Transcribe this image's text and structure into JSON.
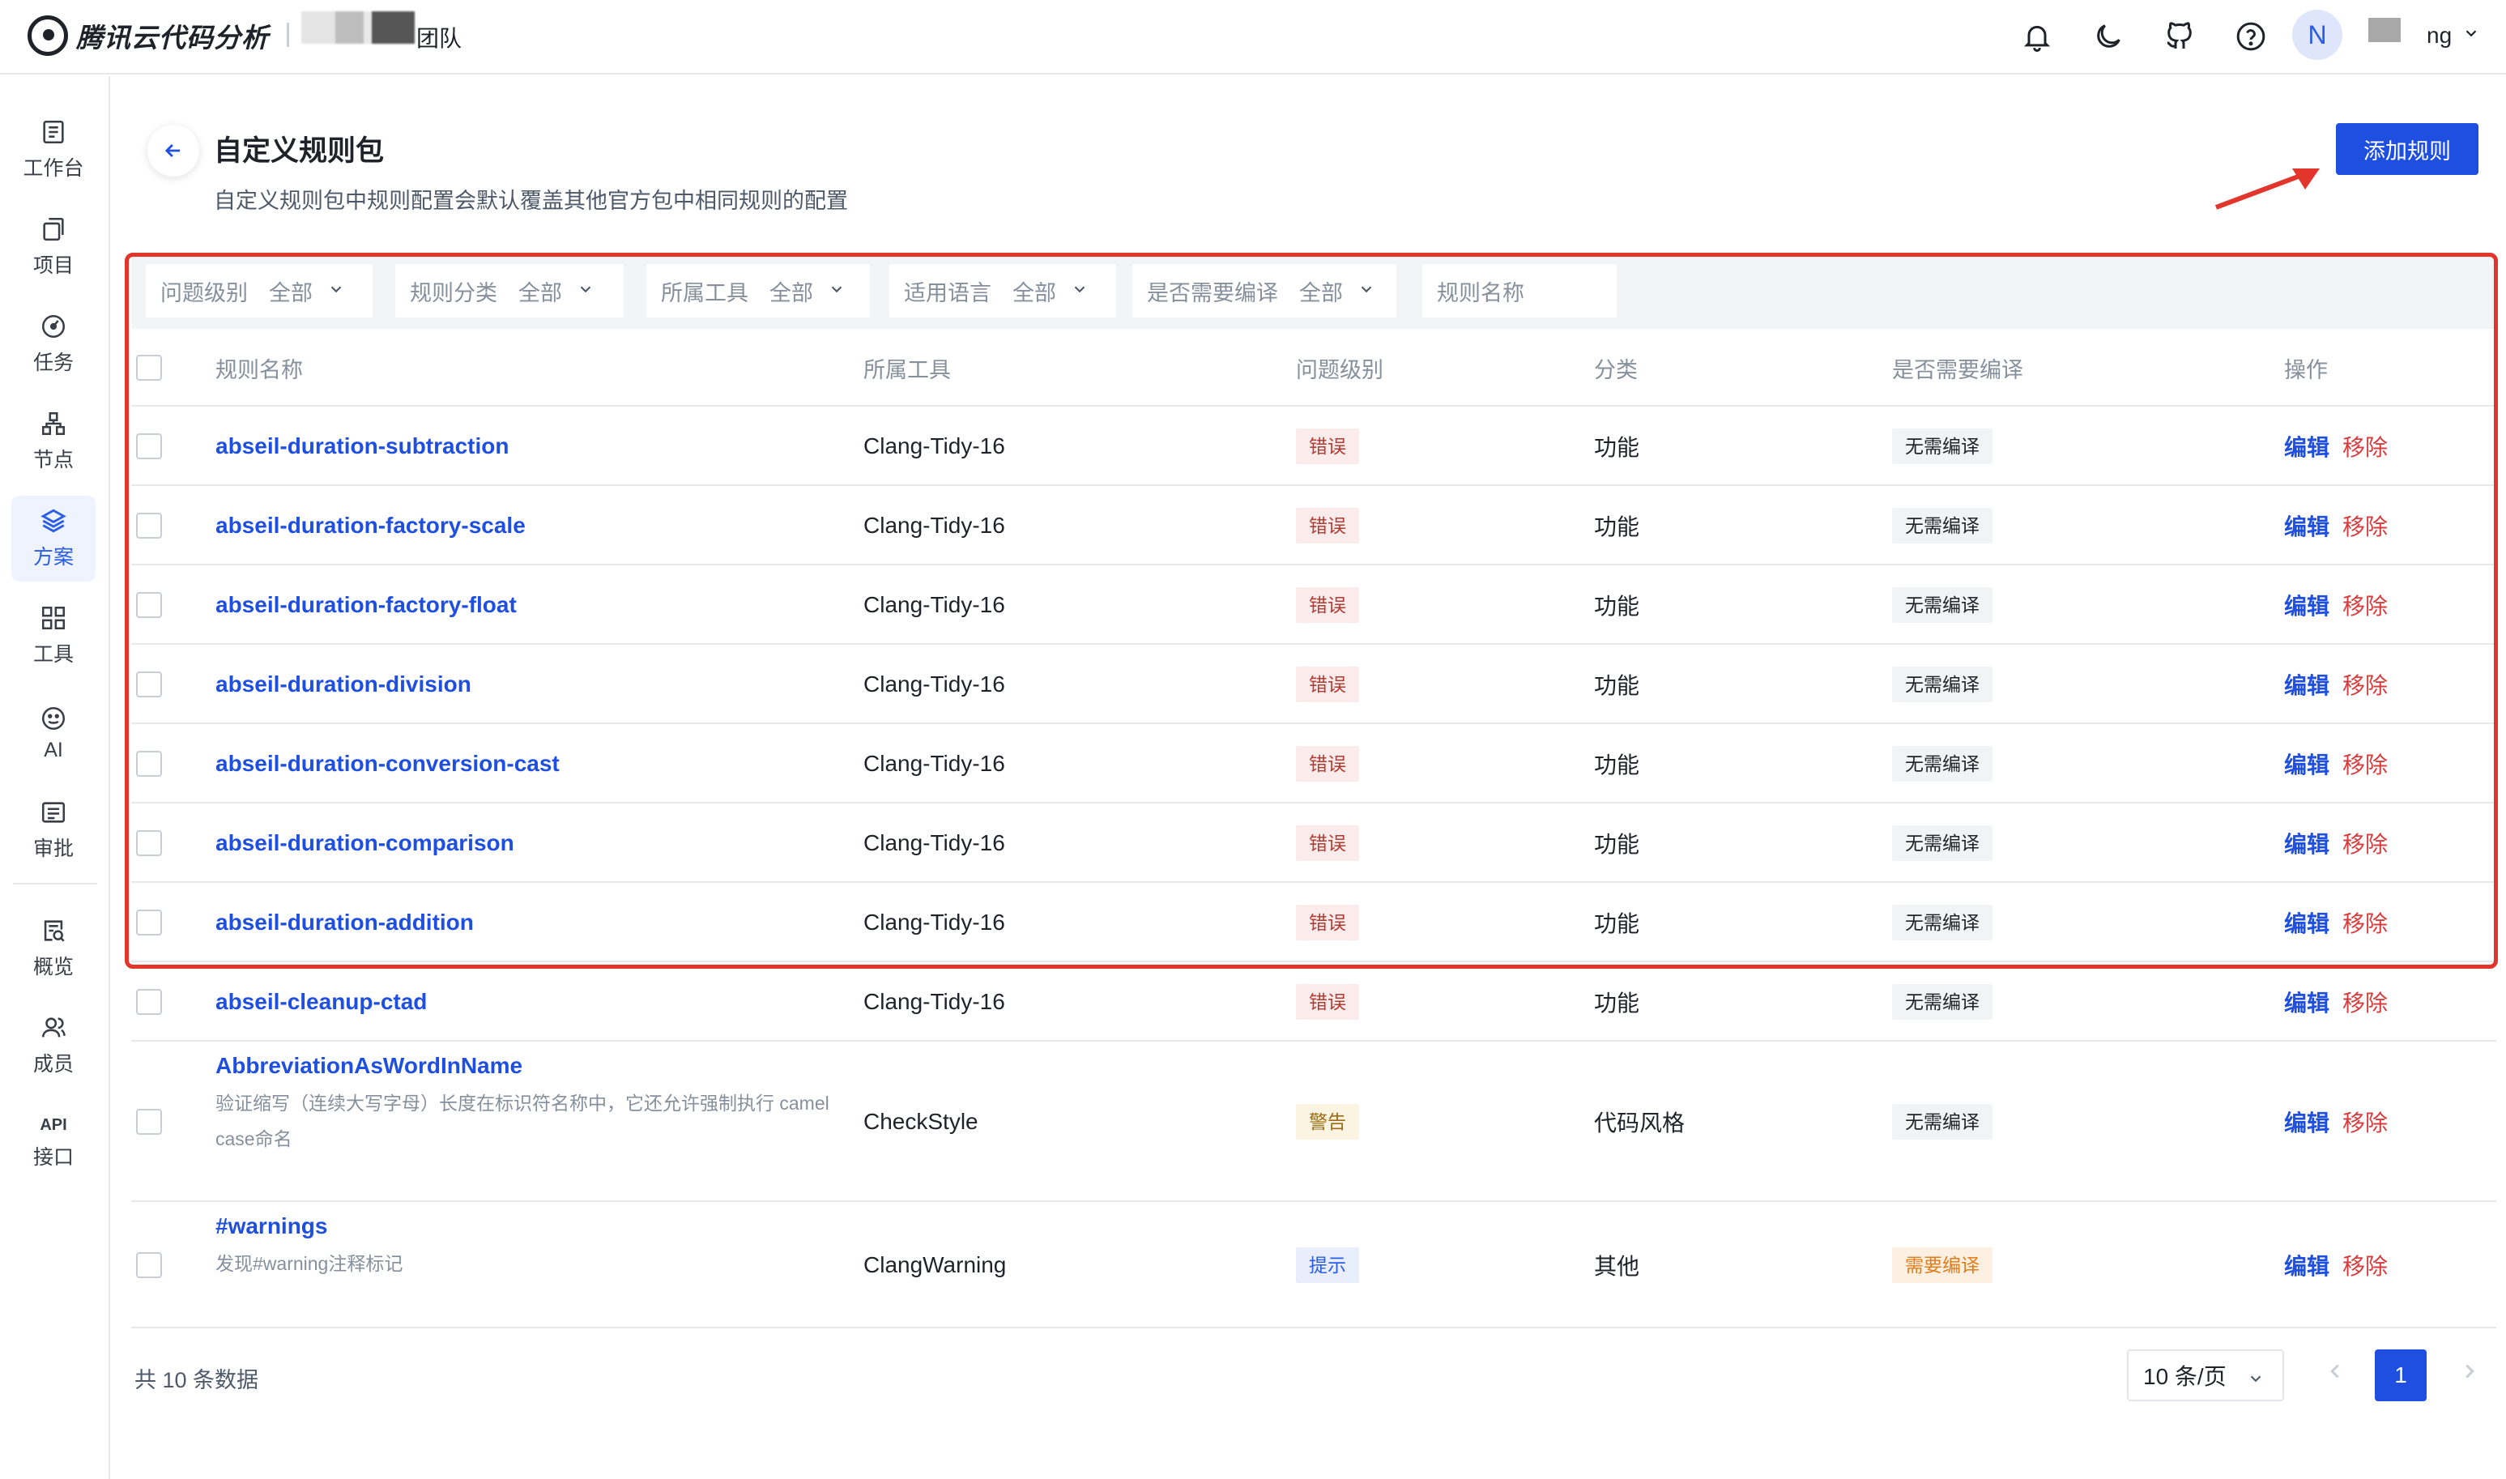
{
  "app": {
    "logo_text": "腾讯云代码分析",
    "team_name": "团队",
    "user_initial": "N",
    "user_name": "ng"
  },
  "topbar_icons": [
    "bell-icon",
    "moon-icon",
    "github-icon",
    "help-icon"
  ],
  "sidebar": {
    "items": [
      {
        "label": "工作台",
        "icon": "workbench-icon"
      },
      {
        "label": "项目",
        "icon": "project-icon"
      },
      {
        "label": "任务",
        "icon": "task-icon"
      },
      {
        "label": "节点",
        "icon": "node-icon"
      },
      {
        "label": "方案",
        "icon": "scheme-icon",
        "active": true
      },
      {
        "label": "工具",
        "icon": "tools-icon"
      },
      {
        "label": "AI",
        "icon": "ai-icon"
      },
      {
        "label": "审批",
        "icon": "approval-icon"
      },
      {
        "label": "概览",
        "icon": "overview-icon"
      },
      {
        "label": "成员",
        "icon": "members-icon"
      },
      {
        "label": "接口",
        "icon_text": "API"
      }
    ]
  },
  "header": {
    "title": "自定义规则包",
    "subtitle": "自定义规则包中规则配置会默认覆盖其他官方包中相同规则的配置",
    "add_button": "添加规则"
  },
  "filters": [
    {
      "label": "问题级别",
      "value": "全部"
    },
    {
      "label": "规则分类",
      "value": "全部"
    },
    {
      "label": "所属工具",
      "value": "全部"
    },
    {
      "label": "适用语言",
      "value": "全部"
    },
    {
      "label": "是否需要编译",
      "value": "全部"
    }
  ],
  "search_placeholder": "规则名称",
  "table": {
    "columns": [
      "规则名称",
      "所属工具",
      "问题级别",
      "分类",
      "是否需要编译",
      "操作"
    ],
    "rows": [
      {
        "name": "abseil-duration-subtraction",
        "desc": "",
        "tool": "Clang-Tidy-16",
        "level": "错误",
        "level_type": "err",
        "category": "功能",
        "compile": "无需编译",
        "compile_type": "nc"
      },
      {
        "name": "abseil-duration-factory-scale",
        "desc": "",
        "tool": "Clang-Tidy-16",
        "level": "错误",
        "level_type": "err",
        "category": "功能",
        "compile": "无需编译",
        "compile_type": "nc"
      },
      {
        "name": "abseil-duration-factory-float",
        "desc": "",
        "tool": "Clang-Tidy-16",
        "level": "错误",
        "level_type": "err",
        "category": "功能",
        "compile": "无需编译",
        "compile_type": "nc"
      },
      {
        "name": "abseil-duration-division",
        "desc": "",
        "tool": "Clang-Tidy-16",
        "level": "错误",
        "level_type": "err",
        "category": "功能",
        "compile": "无需编译",
        "compile_type": "nc"
      },
      {
        "name": "abseil-duration-conversion-cast",
        "desc": "",
        "tool": "Clang-Tidy-16",
        "level": "错误",
        "level_type": "err",
        "category": "功能",
        "compile": "无需编译",
        "compile_type": "nc"
      },
      {
        "name": "abseil-duration-comparison",
        "desc": "",
        "tool": "Clang-Tidy-16",
        "level": "错误",
        "level_type": "err",
        "category": "功能",
        "compile": "无需编译",
        "compile_type": "nc"
      },
      {
        "name": "abseil-duration-addition",
        "desc": "",
        "tool": "Clang-Tidy-16",
        "level": "错误",
        "level_type": "err",
        "category": "功能",
        "compile": "无需编译",
        "compile_type": "nc"
      },
      {
        "name": "abseil-cleanup-ctad",
        "desc": "",
        "tool": "Clang-Tidy-16",
        "level": "错误",
        "level_type": "err",
        "category": "功能",
        "compile": "无需编译",
        "compile_type": "nc"
      },
      {
        "name": "AbbreviationAsWordInName",
        "desc": "验证缩写（连续大写字母）长度在标识符名称中，它还允许强制执行 camel case命名",
        "tool": "CheckStyle",
        "level": "警告",
        "level_type": "warn",
        "category": "代码风格",
        "compile": "无需编译",
        "compile_type": "nc"
      },
      {
        "name": "#warnings",
        "desc": "发现#warning注释标记",
        "tool": "ClangWarning",
        "level": "提示",
        "level_type": "hint",
        "category": "其他",
        "compile": "需要编译",
        "compile_type": "need"
      }
    ],
    "edit_label": "编辑",
    "remove_label": "移除"
  },
  "footer": {
    "total": "共 10 条数据",
    "page_size": "10 条/页",
    "current_page": "1"
  }
}
